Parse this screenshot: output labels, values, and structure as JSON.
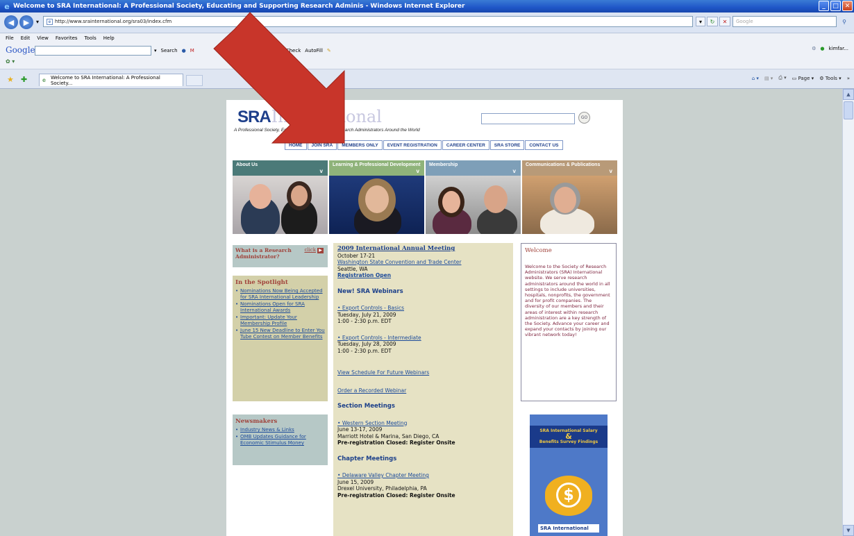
{
  "window": {
    "title": "Welcome to SRA International: A Professional Society, Educating and Supporting Research Adminis - Windows Internet Explorer",
    "min": "_",
    "max": "□",
    "close": "✕"
  },
  "address": {
    "url": "http://www.srainternational.org/sra03/index.cfm",
    "search_placeholder": "Google"
  },
  "menu": [
    "File",
    "Edit",
    "View",
    "Favorites",
    "Tools",
    "Help"
  ],
  "google_toolbar": {
    "logo": "Google",
    "items": [
      "Search",
      "Check",
      "AutoFill"
    ],
    "right_label": "kimfar..."
  },
  "tab": {
    "label": "Welcome to SRA International: A Professional Society..."
  },
  "command_bar": [
    "Page",
    "Tools"
  ],
  "page": {
    "logo_sra": "SRA",
    "logo_intl": "International",
    "tagline": "A Professional Society, Educating and Supporting Research Administrators Around the World",
    "go_label": "GO",
    "nav": [
      "HOME",
      "JOIN SRA",
      "MEMBERS ONLY",
      "EVENT REGISTRATION",
      "CAREER CENTER",
      "SRA STORE",
      "CONTACT US"
    ],
    "categories": [
      {
        "label": "About Us",
        "color": "#4b7a78"
      },
      {
        "label": "Learning & Professional Development",
        "color": "#8fb37a"
      },
      {
        "label": "Membership",
        "color": "#7e9fb8"
      },
      {
        "label": "Communications & Publications",
        "color": "#b89a78"
      }
    ],
    "what_is": {
      "title": "What is a Research Administrator?",
      "click": "click"
    },
    "spotlight": {
      "title": "In the Spotlight",
      "items": [
        "Nominations Now Being Accepted for SRA International Leadership",
        "Nominations Open for SRA International Awards",
        "Important: Update Your Membership Profile",
        "June 15 New Deadline to Enter You Tube Contest on Member Benefits"
      ]
    },
    "newsmakers": {
      "title": "Newsmakers",
      "items": [
        "Industry News & Links",
        "OMB Updates Guidance for Economic Stimulus Money"
      ]
    },
    "meeting": {
      "title": "2009 International Annual Meeting",
      "dates": "October 17-21",
      "venue": "Washington State Convention and Trade Center",
      "city": "Seattle, WA",
      "registration": "Registration Open"
    },
    "webinars": {
      "title": "New! SRA Webinars",
      "items": [
        {
          "name": "Export Controls - Basics",
          "date": "Tuesday, July 21, 2009",
          "time": "1:00 - 2:30 p.m. EDT"
        },
        {
          "name": "Export Controls - Intermediate",
          "date": "Tuesday, July 28, 2009",
          "time": "1:00 - 2:30 p.m. EDT"
        }
      ],
      "schedule_link": "View Schedule For Future Webinars",
      "order_link": "Order a Recorded Webinar"
    },
    "section_meetings": {
      "title": "Section Meetings",
      "name": "Western Section Meeting",
      "dates": "June 13-17, 2009",
      "location": "Marriott Hotel & Marina, San Diego, CA",
      "status": "Pre-registration Closed: Register Onsite"
    },
    "chapter_meetings": {
      "title": "Chapter Meetings",
      "name": "Delaware Valley Chapter Meeting",
      "dates": "June 15, 2009",
      "location": "Drexel University, Philadelphia, PA",
      "status": "Pre-registration Closed: Register Onsite"
    },
    "welcome": {
      "title": "Welcome",
      "body": "Welcome to the Society of Research Administrators (SRA) International website. We serve research administrators around the world in all settings to include universities, hospitals, nonprofits, the government and for profit companies. The diversity of our members and their areas of interest within research administration are a key strength of the Society. Advance your career and expand your contacts by joining our vibrant network today!"
    },
    "survey": {
      "line1": "SRA International Salary",
      "amp": "&",
      "line2": "Benefits Survey Findings",
      "symbol": "$",
      "footer": "SRA International"
    }
  },
  "colors": {
    "arrow": "#c8352a",
    "page_bg": "#c9d1cf"
  }
}
